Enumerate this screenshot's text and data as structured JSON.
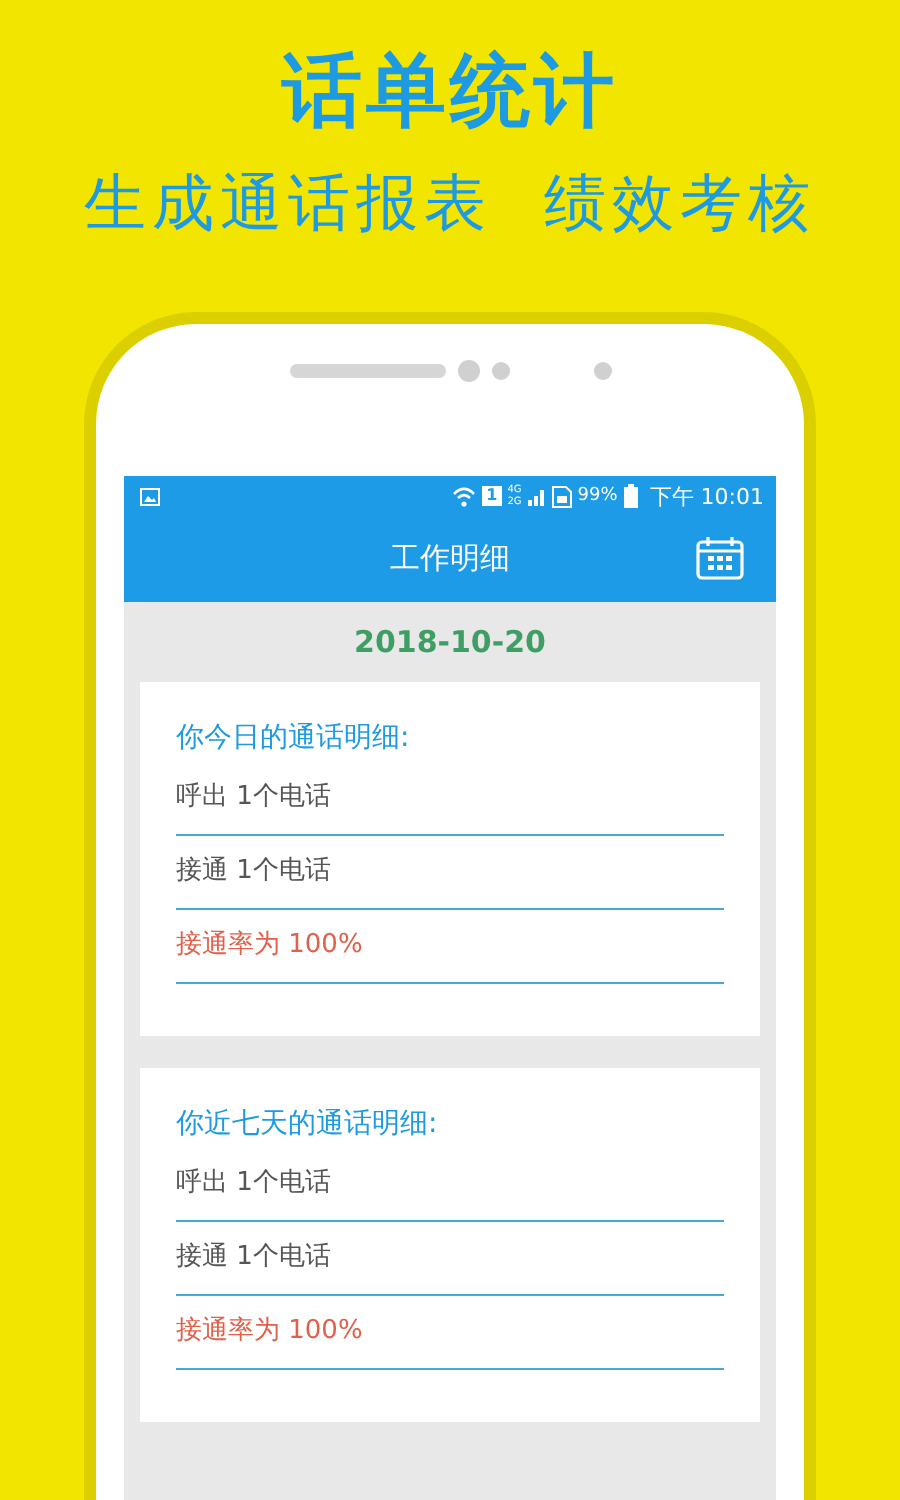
{
  "headline": "话单统计",
  "subtitle": "生成通话报表  绩效考核",
  "status_bar": {
    "sim": "1",
    "network_top": "4G",
    "network_bottom": "2G",
    "battery": "99%",
    "time": "下午 10:01"
  },
  "toolbar": {
    "title": "工作明细"
  },
  "date": "2018-10-20",
  "cards": [
    {
      "title": "你今日的通话明细:",
      "lines": [
        {
          "kind": "count",
          "text": "呼出 1个电话"
        },
        {
          "kind": "count",
          "text": "接通 1个电话"
        },
        {
          "kind": "rate",
          "text": "接通率为 100%"
        }
      ]
    },
    {
      "title": "你近七天的通话明细:",
      "lines": [
        {
          "kind": "count",
          "text": "呼出 1个电话"
        },
        {
          "kind": "count",
          "text": "接通 1个电话"
        },
        {
          "kind": "rate",
          "text": "接通率为 100%"
        }
      ]
    }
  ]
}
